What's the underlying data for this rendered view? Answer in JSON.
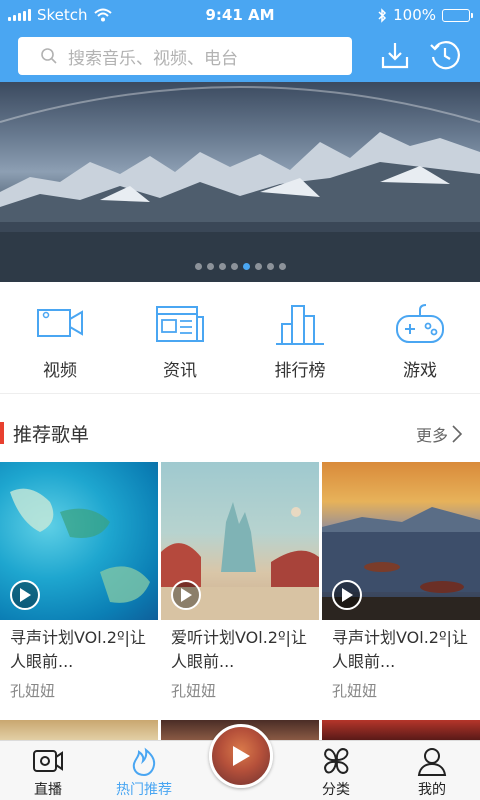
{
  "status_bar": {
    "carrier": "Sketch",
    "time": "9:41 AM",
    "battery": "100%"
  },
  "search": {
    "placeholder": "搜索音乐、视频、电台"
  },
  "banner": {
    "image_alt": "snowy mountains over lake",
    "slide_count": 8,
    "active_slide": 5
  },
  "categories": [
    {
      "label": "视频",
      "icon": "video-camera-icon"
    },
    {
      "label": "资讯",
      "icon": "news-icon"
    },
    {
      "label": "排行榜",
      "icon": "ranking-icon"
    },
    {
      "label": "游戏",
      "icon": "gamepad-icon"
    }
  ],
  "section": {
    "title": "推荐歌单",
    "more": "更多"
  },
  "playlists": [
    {
      "title": "寻声计划VOl.2º|让人眼前...",
      "author": "孔妞妞"
    },
    {
      "title": "爱听计划VOl.2º|让人眼前...",
      "author": "孔妞妞"
    },
    {
      "title": "寻声计划VOl.2º|让人眼前...",
      "author": "孔妞妞"
    }
  ],
  "tabbar": [
    {
      "label": "直播",
      "icon": "live-camera-icon"
    },
    {
      "label": "热门推荐",
      "icon": "flame-icon",
      "active": true
    },
    {
      "label": "",
      "icon": "play-disc-icon"
    },
    {
      "label": "分类",
      "icon": "clover-icon"
    },
    {
      "label": "我的",
      "icon": "person-icon"
    }
  ],
  "colors": {
    "accent": "#4aa6f2",
    "section_bar": "#e8402f"
  }
}
